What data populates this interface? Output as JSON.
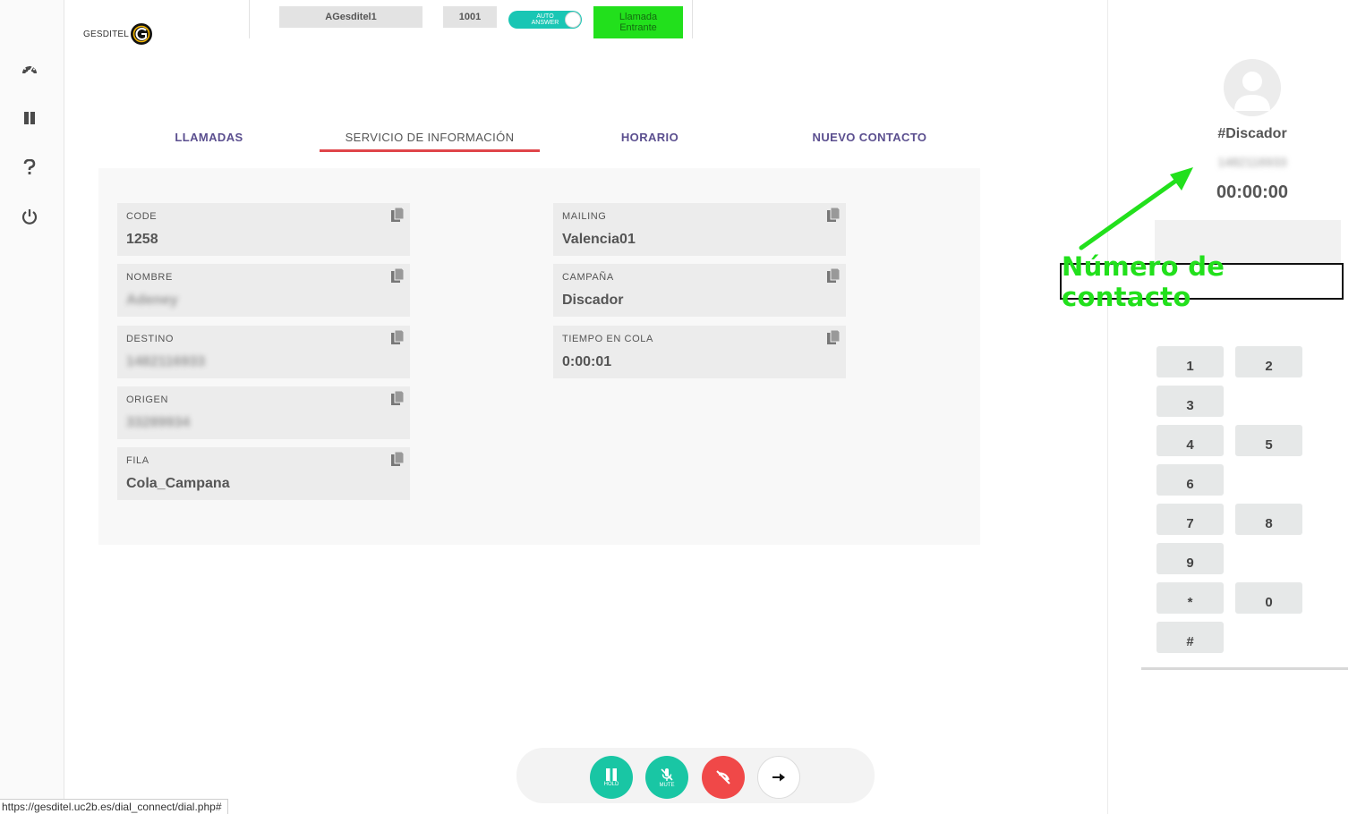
{
  "sidebar": {
    "items": [
      {
        "icon": "dashboard-icon"
      },
      {
        "icon": "pause-icon"
      },
      {
        "icon": "help-icon"
      },
      {
        "icon": "power-icon"
      }
    ]
  },
  "header": {
    "logo_text": "GESDITEL",
    "agent_name": "AGesditel1",
    "extension": "1001",
    "auto_answer_label_1": "AUTO",
    "auto_answer_label_2": "ANSWER",
    "auto_answer_on": true,
    "incoming_call_line1": "Llamada",
    "incoming_call_line2": "Entrante"
  },
  "tabs": [
    {
      "label": "LLAMADAS",
      "active": false
    },
    {
      "label": "SERVICIO DE INFORMACIÓN",
      "active": true
    },
    {
      "label": "HORARIO",
      "active": false
    },
    {
      "label": "NUEVO CONTACTO",
      "active": false
    }
  ],
  "info": {
    "left": [
      {
        "label": "CODE",
        "value": "1258",
        "blurred": false
      },
      {
        "label": "NOMBRE",
        "value": "Adeney",
        "blurred": true
      },
      {
        "label": "DESTINO",
        "value": "1482116933",
        "blurred": true
      },
      {
        "label": "ORIGEN",
        "value": "33289934",
        "blurred": true
      },
      {
        "label": "FILA",
        "value": "Cola_Campana",
        "blurred": false
      }
    ],
    "right": [
      {
        "label": "MAILING",
        "value": "Valencia01",
        "blurred": false
      },
      {
        "label": "CAMPAÑA",
        "value": "Discador",
        "blurred": false
      },
      {
        "label": "TIEMPO EN COLA",
        "value": "0:00:01",
        "blurred": false
      }
    ]
  },
  "call_controls": {
    "hold_label": "HOLD",
    "mute_label": "MUTE",
    "hangup_icon": "hangup-icon",
    "transfer_icon": "arrow-right-icon"
  },
  "phone": {
    "caller_title": "#Discador",
    "caller_number": "1482116933",
    "timer": "00:00:00",
    "annotation": "Número de contacto",
    "keys": [
      "1",
      "2",
      "3",
      "4",
      "5",
      "6",
      "7",
      "8",
      "9",
      "*",
      "0",
      "#"
    ]
  },
  "status_url": "https://gesditel.uc2b.es/dial_connect/dial.php#",
  "colors": {
    "tab_accent": "#e0454a",
    "tab_text": "#5b4f8f",
    "toggle": "#19c6b4",
    "incoming": "#22e01c",
    "hold": "#19c6a4",
    "hangup": "#f04848",
    "annotation": "#22e01c"
  }
}
